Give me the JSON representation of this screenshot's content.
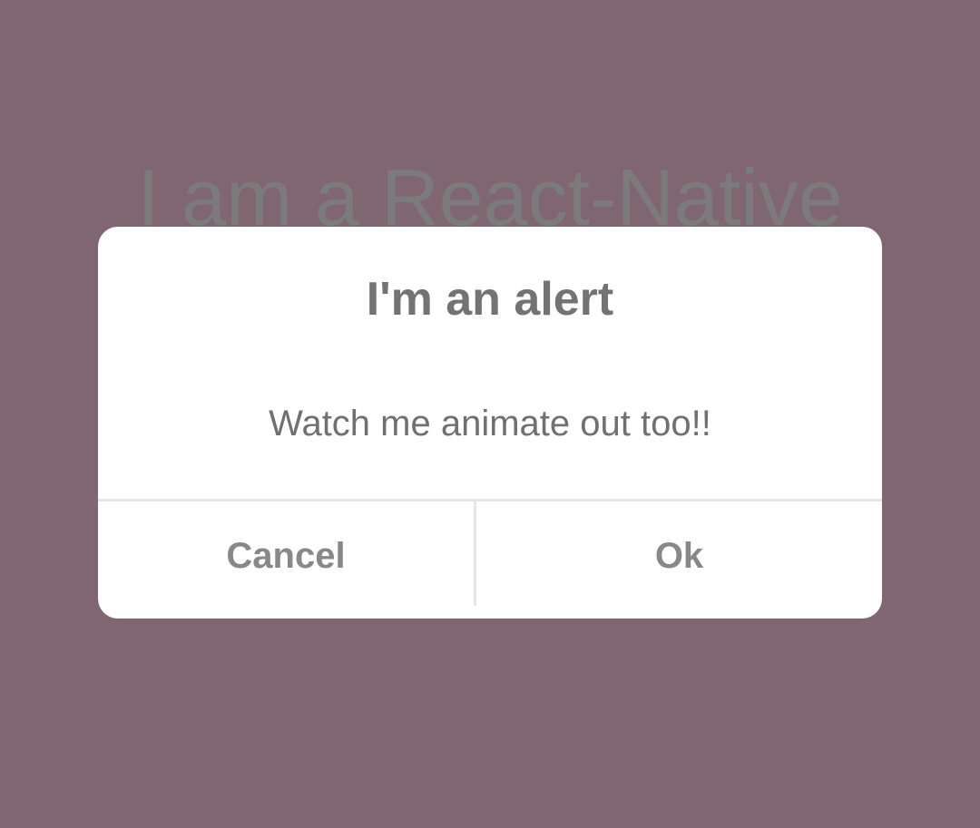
{
  "background": {
    "text": "I am a React-Native",
    "color": "#7f6670"
  },
  "alert": {
    "title": "I'm an alert",
    "message": "Watch me animate out too!!",
    "buttons": {
      "cancel": "Cancel",
      "ok": "Ok"
    }
  }
}
